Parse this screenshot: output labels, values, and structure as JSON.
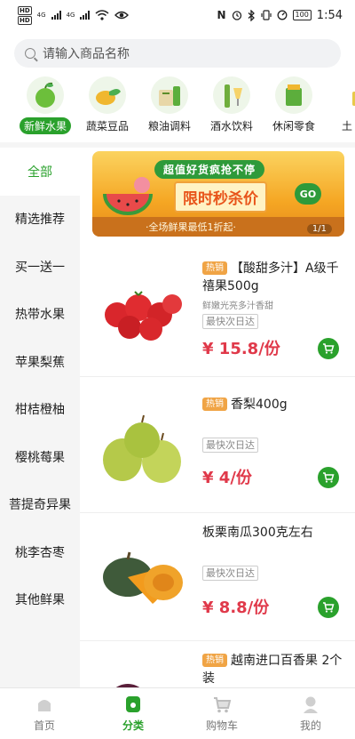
{
  "status_bar": {
    "hd1": "HD",
    "hd2": "HD",
    "net1": "4G",
    "net2": "4G",
    "battery": "100",
    "time": "1:54"
  },
  "search": {
    "placeholder": "请输入商品名称"
  },
  "categories": [
    {
      "label": "新鲜水果",
      "icon": "fruit-icon",
      "active": true
    },
    {
      "label": "蔬菜豆品",
      "icon": "vegetable-icon",
      "active": false
    },
    {
      "label": "粮油调料",
      "icon": "grain-oil-icon",
      "active": false
    },
    {
      "label": "酒水饮料",
      "icon": "drinks-icon",
      "active": false
    },
    {
      "label": "休闲零食",
      "icon": "snacks-icon",
      "active": false
    },
    {
      "label": "土",
      "icon": "local-icon",
      "active": false
    }
  ],
  "sidebar": {
    "items": [
      "全部",
      "精选推荐",
      "买一送一",
      "热带水果",
      "苹果梨蕉",
      "柑桔橙柚",
      "樱桃莓果",
      "菩提奇异果",
      "桃李杏枣",
      "其他鲜果"
    ],
    "active_index": 0
  },
  "banner": {
    "title": "超值好货疯抢不停",
    "main": "限时秒杀价",
    "go": "GO",
    "subtitle": "·全场鲜果最低1折起·",
    "page": "1/1"
  },
  "products": [
    {
      "hot": "热销",
      "name": "【酸甜多汁】A级千禧果500g",
      "desc": "鲜嫩光亮多汁香甜",
      "tag": "最快次日达",
      "price": "¥ 15.8/份"
    },
    {
      "hot": "热销",
      "name": "香梨400g",
      "desc": "",
      "tag": "最快次日达",
      "price": "¥ 4/份"
    },
    {
      "hot": "",
      "name": "板栗南瓜300克左右",
      "desc": "",
      "tag": "最快次日达",
      "price": "¥ 8.8/份"
    },
    {
      "hot": "热销",
      "name": "越南进口百香果 2个装",
      "desc": "",
      "tag": "",
      "price": ""
    }
  ],
  "bottom_nav": [
    {
      "label": "首页",
      "icon": "home-icon",
      "active": false
    },
    {
      "label": "分类",
      "icon": "category-icon",
      "active": true
    },
    {
      "label": "购物车",
      "icon": "cart-icon",
      "active": false
    },
    {
      "label": "我的",
      "icon": "profile-icon",
      "active": false
    }
  ],
  "colors": {
    "accent": "#2aa12c",
    "price": "#e0394a",
    "hot_badge": "#f0a445"
  }
}
